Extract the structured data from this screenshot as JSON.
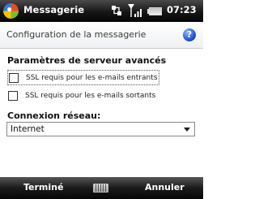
{
  "status_bar": {
    "app_title": "Messagerie",
    "time": "07:23",
    "icons": [
      "windows-flag-icon",
      "connectivity-icon",
      "signal-strength-icon",
      "battery-icon"
    ]
  },
  "title_bar": {
    "title": "Configuration de la messagerie",
    "help_symbol": "?"
  },
  "main": {
    "section_heading": "Paramètres de serveur avancés",
    "checkboxes": [
      {
        "label": "SSL requis pour les e-mails entrants",
        "checked": false,
        "focused": true
      },
      {
        "label": "SSL requis pour les e-mails sortants",
        "checked": false,
        "focused": false
      }
    ],
    "network_heading": "Connexion réseau:",
    "network_select": {
      "value": "Internet"
    }
  },
  "softkeys": {
    "left": "Terminé",
    "right": "Annuler",
    "center_icon": "keyboard-icon"
  },
  "colors": {
    "bar_dark": "#111111",
    "help_blue": "#1a4fd6",
    "background": "#ffffff"
  }
}
